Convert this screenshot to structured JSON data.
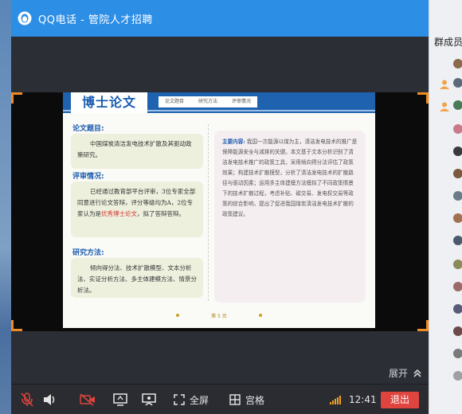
{
  "window": {
    "title": "QQ电话 - 管院人才招聘"
  },
  "slide": {
    "title": "博士论文",
    "tabs": [
      "论文题目",
      "研究方法",
      "评审情况"
    ],
    "topic_label": "论文题目:",
    "topic_text": "中国煤炭清洁发电技术扩散及其驱动政策研究。",
    "review_label": "评审情况:",
    "review_text_a": "已经通过教育部平台评审，3位专家全部同意进行论文答辩，评分等级均为A，2位专家认为是",
    "review_highlight": "优秀博士论文",
    "review_text_b": "，拟了答辩答辩。",
    "method_label": "研究方法:",
    "method_text": "倾向得分法、技术扩散模型、文本分析法、实证分析方法、多主体建模方法、情景分析法。",
    "content_lead": "主要内容:",
    "content_text": "我国一次能源以煤为主，清洁发电技术的推广是保障能源安全与减排的关键。本文基于文本分析识别了清洁发电技术推广的政策工具，采用倾向得分法评估了政策效果；构建技术扩散模型，分析了清洁发电技术的扩散路径与驱动因素；运用多主体建模方法模拟了不同政策情景下的技术扩散过程，考虑补贴、碳交易、发电权交易等政策的综合影响，提出了促进我国煤炭清洁发电技术扩散的政策建议。",
    "footer_page": "第 5 页"
  },
  "controls": {
    "expand_label": "展开",
    "fullscreen_label": "全屏",
    "grid_label": "宫格",
    "time": "12:41",
    "quit_label": "退出"
  },
  "members": {
    "title": "群成员"
  },
  "colors": {
    "titlebar": "#2d8ee6",
    "quit": "#e0443e",
    "slide_accent": "#1f62b0",
    "frame_corner": "#f08a24"
  }
}
